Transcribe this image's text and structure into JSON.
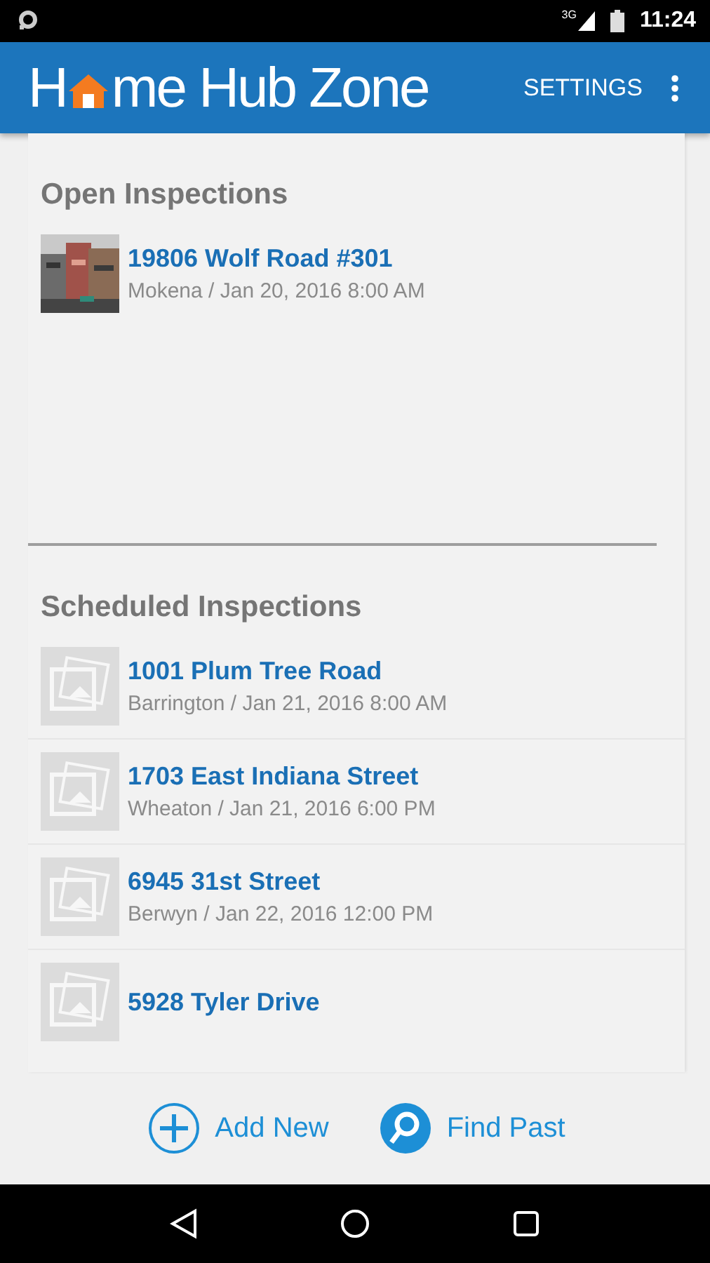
{
  "status_bar": {
    "network": "3G",
    "time": "11:24"
  },
  "app_bar": {
    "logo": {
      "before": "H",
      "after": "me Hub Zone"
    },
    "action": "SETTINGS"
  },
  "sections": [
    {
      "title": "Open Inspections",
      "items": [
        {
          "address": "19806 Wolf Road #301",
          "details": "Mokena / Jan 20, 2016 8:00 AM"
        }
      ]
    },
    {
      "title": "Scheduled Inspections",
      "items": [
        {
          "address": "1001 Plum Tree Road",
          "details": "Barrington / Jan 21, 2016 8:00 AM",
          "kind": "placeholder"
        },
        {
          "address": "1703 East Indiana Street",
          "details": "Wheaton / Jan 21, 2016 6:00 PM",
          "kind": "placeholder"
        },
        {
          "address": "6945 31st Street",
          "details": "Berwyn / Jan 22, 2016 12:00 PM",
          "kind": "placeholder"
        },
        {
          "address": "5928 Tyler Drive",
          "kind": "placeholder"
        }
      ]
    }
  ],
  "bottom_actions": [
    {
      "label": "Add New",
      "kind": "add"
    },
    {
      "label": "Find Past",
      "kind": "search"
    }
  ]
}
